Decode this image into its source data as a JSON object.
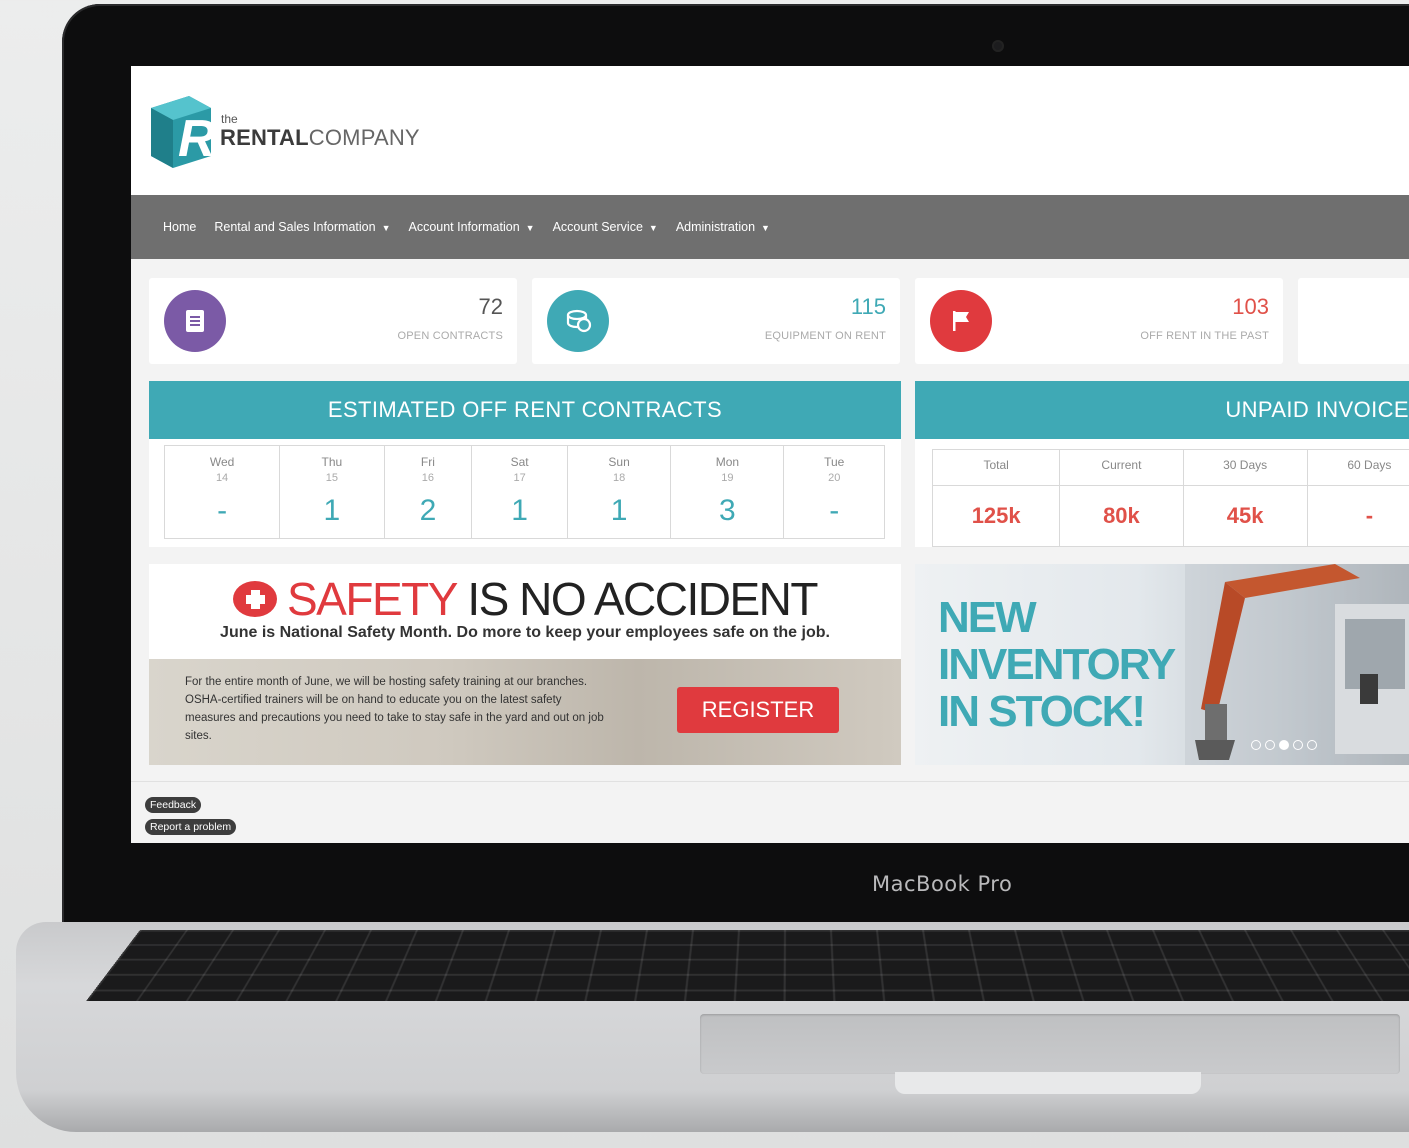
{
  "device": {
    "label": "MacBook Pro"
  },
  "logo": {
    "the": "the",
    "rental": "RENTAL",
    "company": "COMPANY"
  },
  "nav": [
    {
      "label": "Home",
      "caret": false
    },
    {
      "label": "Rental and Sales Information",
      "caret": true
    },
    {
      "label": "Account Information",
      "caret": true
    },
    {
      "label": "Account Service",
      "caret": true
    },
    {
      "label": "Administration",
      "caret": true
    }
  ],
  "stats": [
    {
      "value": "72",
      "label": "OPEN CONTRACTS",
      "color": "#7b5aa6",
      "value_color": "#555555",
      "icon": "document-icon"
    },
    {
      "value": "115",
      "label": "EQUIPMENT ON RENT",
      "color": "#3fa9b5",
      "value_color": "#3fa9b5",
      "icon": "coins-icon"
    },
    {
      "value": "103",
      "label": "OFF RENT IN THE PAST",
      "color": "#e03a3e",
      "value_color": "#e05149",
      "icon": "flag-icon"
    }
  ],
  "off_rent": {
    "title": "ESTIMATED OFF RENT CONTRACTS",
    "days": [
      {
        "day": "Wed",
        "date": "14",
        "value": "-"
      },
      {
        "day": "Thu",
        "date": "15",
        "value": "1"
      },
      {
        "day": "Fri",
        "date": "16",
        "value": "2"
      },
      {
        "day": "Sat",
        "date": "17",
        "value": "1"
      },
      {
        "day": "Sun",
        "date": "18",
        "value": "1"
      },
      {
        "day": "Mon",
        "date": "19",
        "value": "3"
      },
      {
        "day": "Tue",
        "date": "20",
        "value": "-"
      }
    ]
  },
  "unpaid": {
    "title": "UNPAID INVOICE",
    "columns": [
      "Total",
      "Current",
      "30 Days",
      "60 Days"
    ],
    "values": [
      "125k",
      "80k",
      "45k",
      "-"
    ]
  },
  "safety": {
    "title_red": "SAFETY",
    "title_rest": " IS NO ACCIDENT",
    "subtitle": "June is National Safety Month. Do more to keep your employees safe on the job.",
    "body": "For the entire month of June, we will be hosting safety training at our branches. OSHA-certified trainers will be on hand to educate you on the latest safety measures and precautions you need to take to stay safe in the yard and out on job sites.",
    "button": "REGISTER"
  },
  "inventory": {
    "lines": [
      "NEW",
      "INVENTORY",
      "IN STOCK!"
    ],
    "slides_total": 5,
    "slide_active": 3
  },
  "footer": {
    "feedback": "Feedback",
    "report": "Report a problem"
  }
}
